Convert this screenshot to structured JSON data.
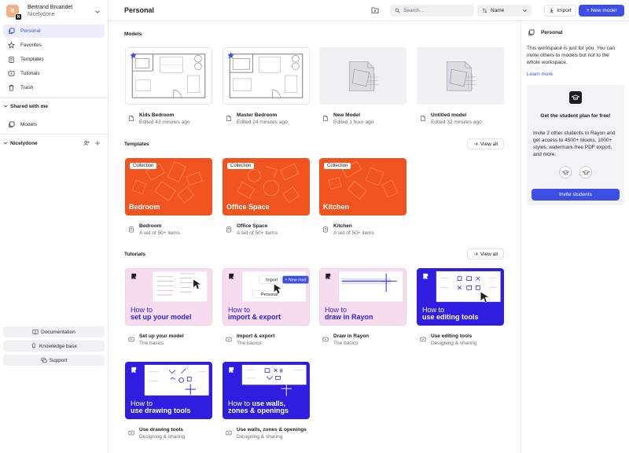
{
  "account": {
    "initial": "B",
    "org_initial": "N",
    "name": "Bertrand Bruandet",
    "org": "Nicelydone"
  },
  "sidebar": {
    "items": [
      {
        "label": "Personal"
      },
      {
        "label": "Favorites"
      },
      {
        "label": "Templates"
      },
      {
        "label": "Tutorials"
      },
      {
        "label": "Trash"
      }
    ],
    "shared_title": "Shared with me",
    "shared_items": [
      {
        "label": "Models"
      }
    ],
    "team_title": "Nicelydone",
    "bottom": [
      {
        "label": "Documentation"
      },
      {
        "label": "Knowledge base"
      },
      {
        "label": "Support"
      }
    ]
  },
  "topbar": {
    "title": "Personal",
    "search_placeholder": "Search...",
    "sort_label": "Name",
    "import_label": "Import",
    "new_model_label": "+ New model"
  },
  "models": {
    "title": "Models",
    "items": [
      {
        "name": "Kids Bedroom",
        "edited": "Edited 43 minutes ago"
      },
      {
        "name": "Master Bedroom",
        "edited": "Edited 24 minutes ago"
      },
      {
        "name": "New Model",
        "edited": "Edited 1 hour ago"
      },
      {
        "name": "Untitled model",
        "edited": "Edited 32 minutes ago"
      }
    ]
  },
  "templates": {
    "title": "Templates",
    "view_all": "View all",
    "badge": "Collection",
    "items": [
      {
        "name": "Bedroom",
        "sub": "A set of 50+ items"
      },
      {
        "name": "Office Space",
        "sub": "A set of 50+ items"
      },
      {
        "name": "Kitchen",
        "sub": "A set of 50+ items"
      }
    ]
  },
  "tutorials": {
    "title": "Tutorials",
    "view_all": "View all",
    "thumb_text": {
      "t1_a": "How to",
      "t1_b": "set up your model",
      "t2_a": "How to",
      "t2_b": "import & export",
      "t2_import": "Import",
      "t2_new": "+ New mod",
      "t2_personal": "Personal",
      "t3_a": "How to",
      "t3_b": "draw in Rayon",
      "t4_a": "How to",
      "t4_b": "use editing tools",
      "t5_a": "How to",
      "t5_b": "use drawing tools",
      "t6_a": "How to",
      "t6_b": "use walls,",
      "t6_c": "zones & openings"
    },
    "items": [
      {
        "name": "Set up your model",
        "sub": "The basics"
      },
      {
        "name": "Import & export",
        "sub": "The basics"
      },
      {
        "name": "Draw in Rayon",
        "sub": "The basics"
      },
      {
        "name": "Use editing tools",
        "sub": "Designing & sharing"
      },
      {
        "name": "Use drawing tools",
        "sub": "Designing & sharing"
      },
      {
        "name": "Use walls, zones & openings",
        "sub": "Designing & sharing"
      }
    ]
  },
  "right_panel": {
    "title": "Personal",
    "description": "This workspace is just for you. You can invite others to models but not to the whole workspace.",
    "learn_more": "Learn more",
    "promo_title": "Get the student plan for free!",
    "promo_text": "Invite 2 other students to Rayon and get access to 4500+ blocks, 1000+ styles, watermark-free PDF export, and more.",
    "invite_label": "Invite students"
  },
  "colors": {
    "accent": "#3c4ee4",
    "template_orange": "#f2541f",
    "tutorial_pink": "#f7dcef",
    "tutorial_blue": "#2f1ee0"
  }
}
